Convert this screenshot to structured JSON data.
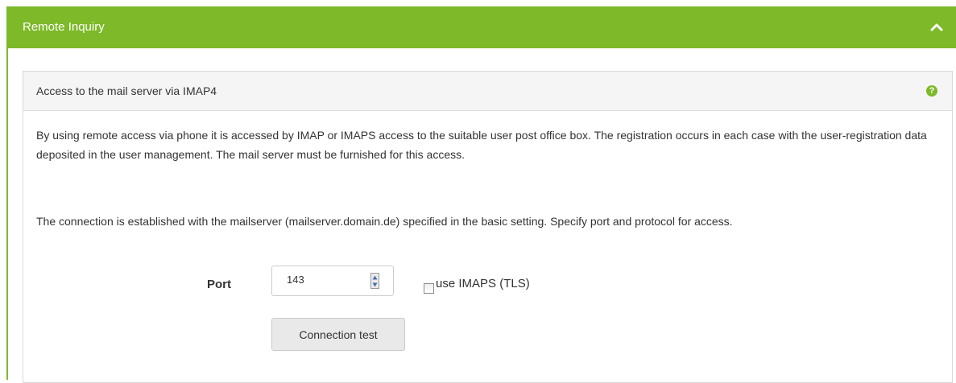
{
  "panel": {
    "title": "Remote Inquiry",
    "collapse_icon": "chevron-up-icon",
    "accent_color": "#7db928"
  },
  "section": {
    "heading": "Access to the mail server via IMAP4",
    "help_icon": "question-circle-icon",
    "help_glyph": "?",
    "paragraphs": [
      "By using remote access via phone it is accessed by IMAP or IMAPS access to the suitable user post office box. The registration occurs in each case with the user-registration data deposited in the user management. The mail server must be furnished for this access.",
      "The connection is established with the mailserver (mailserver.domain.de) specified in the basic setting. Specify port and protocol for access."
    ]
  },
  "form": {
    "port_label": "Port",
    "port_value": "143",
    "imaps_label": "use IMAPS (TLS)",
    "imaps_checked": false,
    "connection_test_label": "Connection test"
  }
}
